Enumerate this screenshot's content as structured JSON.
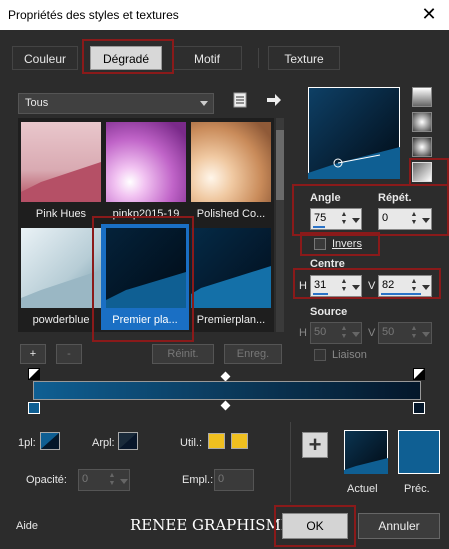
{
  "window": {
    "title": "Propriétés des styles et textures",
    "close_glyph": "✕"
  },
  "tabs": [
    {
      "label": "Couleur"
    },
    {
      "label": "Dégradé"
    },
    {
      "label": "Motif"
    },
    {
      "label": "Texture"
    }
  ],
  "gradient_library": {
    "category": "Tous",
    "items": [
      {
        "label": "Pink Hues"
      },
      {
        "label": "pinkp2015-19"
      },
      {
        "label": "Polished Co..."
      },
      {
        "label": "powderblue"
      },
      {
        "label": "Premier pla..."
      },
      {
        "label": "Premierplan..."
      }
    ],
    "buttons": {
      "add": "+",
      "remove": "-",
      "reset": "Réinit.",
      "save": "Enreg."
    }
  },
  "settings": {
    "angle_label": "Angle",
    "angle_value": "75",
    "repeat_label": "Répét.",
    "repeat_value": "0",
    "invert_label": "Invers",
    "center_label": "Centre",
    "center_h_label": "H",
    "center_h_value": "31",
    "center_v_label": "V",
    "center_v_value": "82",
    "source_label": "Source",
    "source_h_label": "H",
    "source_h_value": "50",
    "source_v_label": "V",
    "source_v_value": "50",
    "link_label": "Liaison"
  },
  "bottom": {
    "fg_label": "1pl:",
    "bg_label": "Arpl:",
    "util_label": "Util.:",
    "opacity_label": "Opacité:",
    "opacity_value": "0",
    "location_label": "Empl.:",
    "location_value": "0",
    "add_glyph": "+",
    "current_label": "Actuel",
    "previous_label": "Préc."
  },
  "footer": {
    "help": "Aide",
    "watermark": "RENEE GRAPHISME",
    "ok": "OK",
    "cancel": "Annuler"
  },
  "colors": {
    "gradient_dark": "#04172a",
    "gradient_light": "#0f5f93",
    "accent_red": "#8a1a1a",
    "swatch_yellow": "#f0c020"
  }
}
